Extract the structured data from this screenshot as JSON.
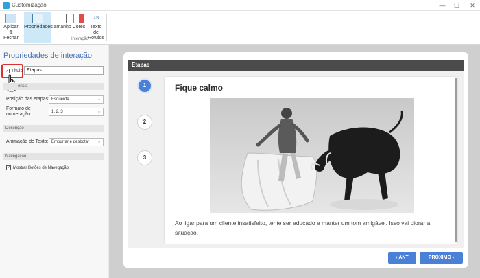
{
  "window": {
    "title": "Customização",
    "min": "—",
    "max": "☐",
    "close": "✕"
  },
  "ribbon": {
    "apply_line1": "Aplicar",
    "apply_line2": "& Fechar",
    "properties": "Propriedades",
    "size": "Tamanho",
    "colors": "Cores",
    "labels_line1": "Texto de",
    "labels_line2": "Rótulos",
    "labels_icon": "AB",
    "group": "Interação"
  },
  "panel": {
    "title": "Propriedades de interação",
    "title_checkbox_label": "Título",
    "title_value": "Etapas",
    "appearance_section": "ência",
    "steps_position_label": "Posição das etapas:",
    "steps_position_value": "Esquerda",
    "numbering_label_line1": "Formato de",
    "numbering_label_line2": "numeração:",
    "numbering_value": "1, 2, 3",
    "description_section": "Descrição",
    "text_animation_label": "Animação de Texto:",
    "text_animation_value": "Empurrar e desbotar",
    "navigation_section": "Navegação",
    "show_nav_buttons_label": "Mostrar Botões de Navegação",
    "checked_mark": "✓",
    "chevron": "⌄"
  },
  "preview": {
    "header": "Etapas",
    "steps": [
      "1",
      "2",
      "3"
    ],
    "slide_title": "Fique calmo",
    "slide_text": "Ao ligar para um cliente insatisfeito, tente ser educado e manter um tom amigável. Isso vai piorar a situação.",
    "prev_button": "‹  ANT",
    "next_button": "PRÓXIMO  ›"
  },
  "colors": {
    "accent": "#4a80d6",
    "header": "#4b4b4b",
    "highlight": "#d83232"
  }
}
